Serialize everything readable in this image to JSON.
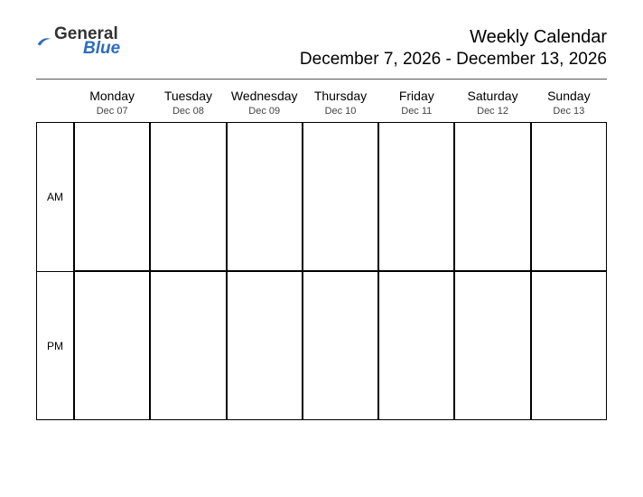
{
  "logo": {
    "text1": "General",
    "text2": "Blue"
  },
  "header": {
    "title": "Weekly Calendar",
    "daterange": "December 7, 2026 - December 13, 2026"
  },
  "periods": {
    "am": "AM",
    "pm": "PM"
  },
  "days": [
    {
      "name": "Monday",
      "date": "Dec 07"
    },
    {
      "name": "Tuesday",
      "date": "Dec 08"
    },
    {
      "name": "Wednesday",
      "date": "Dec 09"
    },
    {
      "name": "Thursday",
      "date": "Dec 10"
    },
    {
      "name": "Friday",
      "date": "Dec 11"
    },
    {
      "name": "Saturday",
      "date": "Dec 12"
    },
    {
      "name": "Sunday",
      "date": "Dec 13"
    }
  ]
}
